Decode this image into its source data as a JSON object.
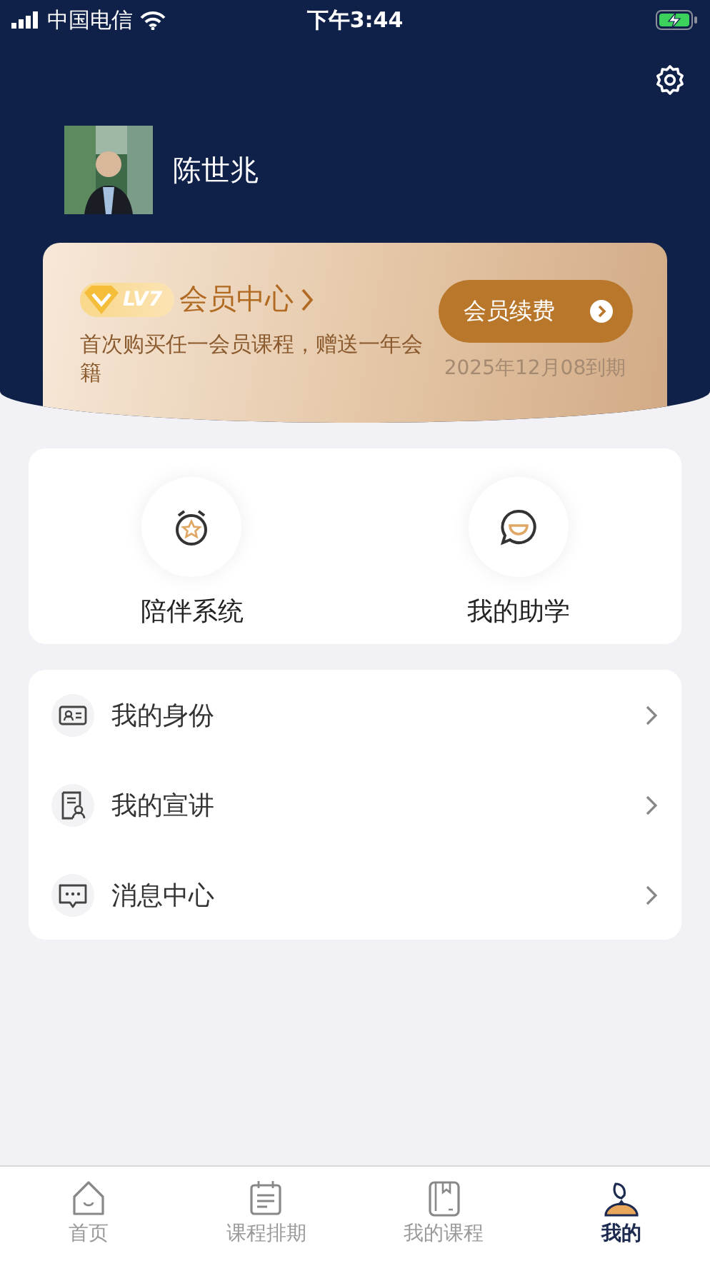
{
  "status_bar": {
    "carrier": "中国电信",
    "time": "下午3:44"
  },
  "profile": {
    "name": "陈世兆"
  },
  "membership": {
    "level": "LV7",
    "title": "会员中心",
    "description": "首次购买任一会员课程，赠送一年会籍",
    "renew_button": "会员续费",
    "expiry": "2025年12月08到期"
  },
  "shortcuts": [
    {
      "label": "陪伴系统",
      "kind": "alarm"
    },
    {
      "label": "我的助学",
      "kind": "chat"
    }
  ],
  "menu": [
    {
      "label": "我的身份",
      "kind": "id"
    },
    {
      "label": "我的宣讲",
      "kind": "speech"
    },
    {
      "label": "消息中心",
      "kind": "message"
    }
  ],
  "tab_bar": [
    {
      "label": "首页",
      "kind": "home",
      "selected": false
    },
    {
      "label": "课程排期",
      "kind": "schedule",
      "selected": false
    },
    {
      "label": "我的课程",
      "kind": "book",
      "selected": false
    },
    {
      "label": "我的",
      "kind": "me",
      "selected": true
    }
  ]
}
